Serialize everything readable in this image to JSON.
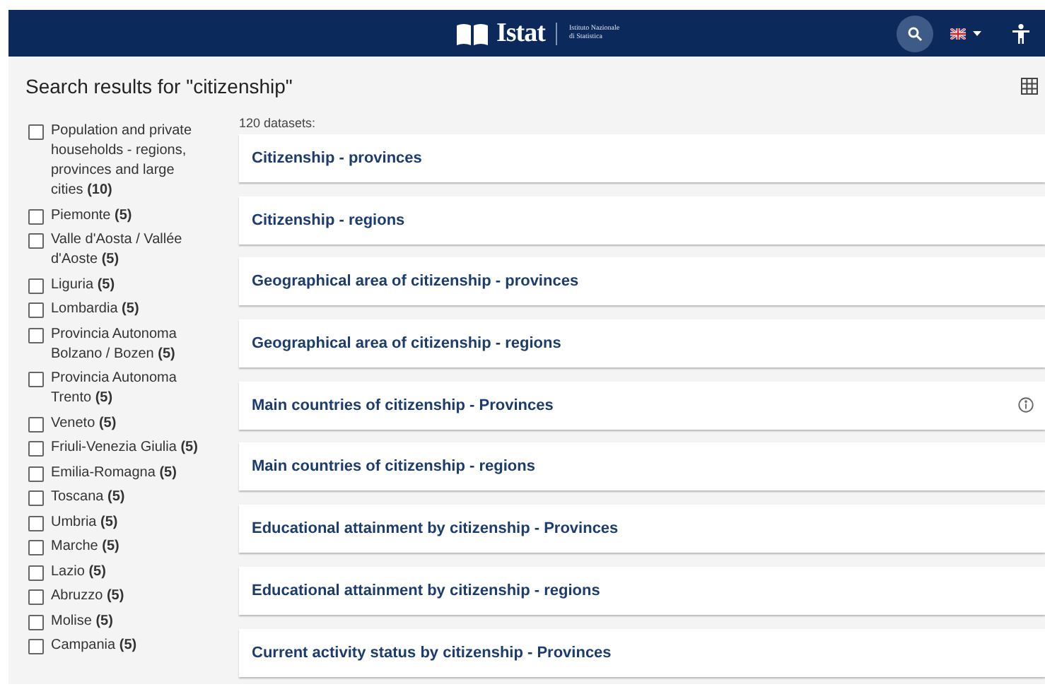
{
  "header": {
    "logo_name": "Istat",
    "logo_subtitle": [
      "Istituto Nazionale",
      "di Statistica"
    ]
  },
  "page_title": "Search results for \"citizenship\"",
  "filters": [
    {
      "label": "Population and private households - regions, provinces and large cities",
      "count": "(10)",
      "checked": false
    },
    {
      "label": "Piemonte",
      "count": "(5)",
      "checked": false
    },
    {
      "label": "Valle d'Aosta / Vallée d'Aoste",
      "count": "(5)",
      "checked": false
    },
    {
      "label": "Liguria",
      "count": "(5)",
      "checked": false
    },
    {
      "label": "Lombardia",
      "count": "(5)",
      "checked": false
    },
    {
      "label": "Provincia Autonoma Bolzano / Bozen",
      "count": "(5)",
      "checked": false
    },
    {
      "label": "Provincia Autonoma Trento",
      "count": "(5)",
      "checked": false
    },
    {
      "label": "Veneto",
      "count": "(5)",
      "checked": false
    },
    {
      "label": "Friuli-Venezia Giulia",
      "count": "(5)",
      "checked": false
    },
    {
      "label": "Emilia-Romagna",
      "count": "(5)",
      "checked": false
    },
    {
      "label": "Toscana",
      "count": "(5)",
      "checked": false
    },
    {
      "label": "Umbria",
      "count": "(5)",
      "checked": false
    },
    {
      "label": "Marche",
      "count": "(5)",
      "checked": false
    },
    {
      "label": "Lazio",
      "count": "(5)",
      "checked": false
    },
    {
      "label": "Abruzzo",
      "count": "(5)",
      "checked": false
    },
    {
      "label": "Molise",
      "count": "(5)",
      "checked": false
    },
    {
      "label": "Campania",
      "count": "(5)",
      "checked": false
    }
  ],
  "result_count": "120 datasets:",
  "datasets": [
    {
      "title": "Citizenship - provinces",
      "info": false
    },
    {
      "title": "Citizenship - regions",
      "info": false
    },
    {
      "title": "Geographical area of citizenship - provinces",
      "info": false
    },
    {
      "title": "Geographical area of citizenship - regions",
      "info": false
    },
    {
      "title": "Main countries of citizenship - Provinces",
      "info": true
    },
    {
      "title": "Main countries of citizenship - regions",
      "info": false
    },
    {
      "title": "Educational attainment by citizenship - Provinces",
      "info": false
    },
    {
      "title": "Educational attainment by citizenship - regions",
      "info": false
    },
    {
      "title": "Current activity status by citizenship - Provinces",
      "info": false
    }
  ]
}
